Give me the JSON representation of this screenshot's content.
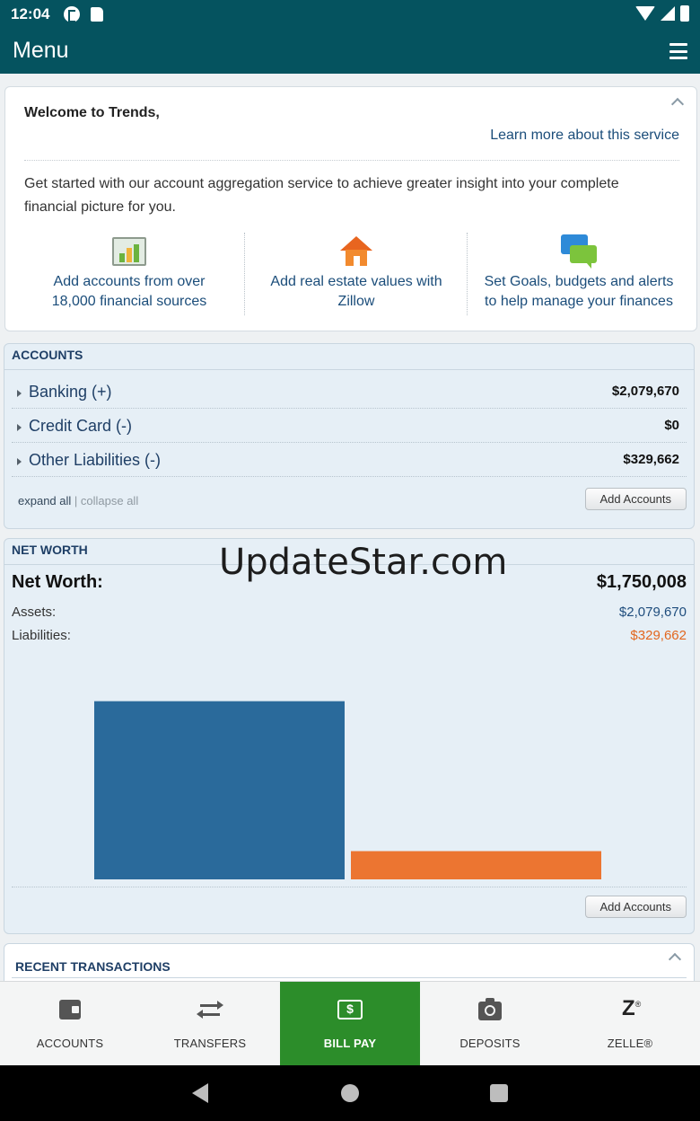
{
  "status_bar": {
    "time": "12:04"
  },
  "header": {
    "title": "Menu"
  },
  "welcome": {
    "title": "Welcome to Trends,",
    "learn_more": "Learn more about this service",
    "description": "Get started with our account aggregation service to achieve greater insight into your complete financial picture for you.",
    "features": [
      {
        "icon": "chart-icon",
        "line1": "Add accounts from over",
        "line2": "18,000 financial sources"
      },
      {
        "icon": "house-icon",
        "line1": "Add real estate values with",
        "line2": "Zillow"
      },
      {
        "icon": "chat-icon",
        "line1": "Set Goals, budgets and alerts",
        "line2": "to help manage your finances"
      }
    ]
  },
  "accounts": {
    "title": "ACCOUNTS",
    "rows": [
      {
        "label": "Banking (+)",
        "amount": "$2,079,670"
      },
      {
        "label": "Credit Card (-)",
        "amount": "$0"
      },
      {
        "label": "Other Liabilities (-)",
        "amount": "$329,662"
      }
    ],
    "expand_all": "expand all",
    "separator": " | ",
    "collapse_all": "collapse all",
    "add_button": "Add Accounts"
  },
  "net_worth": {
    "title": "NET WORTH",
    "label": "Net Worth:",
    "value": "$1,750,008",
    "assets_label": "Assets:",
    "assets_value": "$2,079,670",
    "liabilities_label": "Liabilities:",
    "liabilities_value": "$329,662",
    "add_button": "Add Accounts",
    "colors": {
      "assets": "#2a6a9b",
      "liabilities": "#ec7531"
    }
  },
  "chart_data": {
    "type": "bar",
    "categories": [
      "Assets",
      "Liabilities"
    ],
    "values": [
      2079670,
      329662
    ],
    "title": "",
    "xlabel": "",
    "ylabel": "",
    "ylim": [
      0,
      2600000
    ],
    "grid": false,
    "legend": "none"
  },
  "watermark": "UpdateStar.com",
  "recent_transactions": {
    "title": "RECENT TRANSACTIONS"
  },
  "bottom_nav": {
    "items": [
      {
        "label": "ACCOUNTS",
        "icon": "wallet-icon"
      },
      {
        "label": "TRANSFERS",
        "icon": "transfer-icon"
      },
      {
        "label": "BILL PAY",
        "icon": "bill-pay-icon",
        "active": true
      },
      {
        "label": "DEPOSITS",
        "icon": "camera-icon"
      },
      {
        "label": "ZELLE®",
        "icon": "zelle-icon"
      }
    ],
    "active_color": "#2c8d2a"
  }
}
